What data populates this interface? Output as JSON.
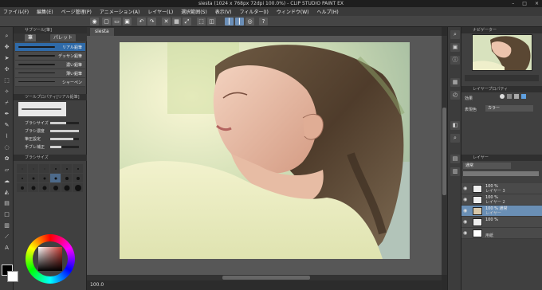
{
  "window": {
    "title": "siesta (1024 x 768px 72dpi 100.0%) - CLIP STUDIO PAINT EX",
    "controls": [
      "–",
      "□",
      "×"
    ]
  },
  "menu": [
    "ファイル(F)",
    "編集(E)",
    "ページ管理(P)",
    "アニメーション(A)",
    "レイヤー(L)",
    "選択範囲(S)",
    "表示(V)",
    "フィルター(I)",
    "ウィンドウ(W)",
    "ヘルプ(H)"
  ],
  "subtool": {
    "header": "サブツール[筆]",
    "tabs": [
      "筆",
      "パレット"
    ],
    "brushes": [
      {
        "label": "リアル鉛筆",
        "selected": true
      },
      {
        "label": "デッサン鉛筆",
        "selected": false
      },
      {
        "label": "濃い鉛筆",
        "selected": false
      },
      {
        "label": "薄い鉛筆",
        "selected": false
      },
      {
        "label": "シャーペン",
        "selected": false
      }
    ]
  },
  "tool_property": {
    "header": "ツールプロパティ[リアル鉛筆]",
    "rows": [
      {
        "label": "ブラシサイズ",
        "value": 0.55
      },
      {
        "label": "ブラシ濃度",
        "value": 1.0
      },
      {
        "label": "筆圧設定",
        "value": 0.8
      },
      {
        "label": "手ブレ補正",
        "value": 0.4
      }
    ]
  },
  "brush_size": {
    "header": "ブラシサイズ",
    "selected_index": 9
  },
  "document_tab": "siesta",
  "status": {
    "zoom": "100.0"
  },
  "right_panel": {
    "navigator_header": "ナビゲーター",
    "property_header": "レイヤープロパティ",
    "effect_label": "効果",
    "color_label": "表現色",
    "color_value": "カラー",
    "layer_header": "レイヤー",
    "blend_mode": "通常",
    "layers": [
      {
        "name": "100 %",
        "sub": "レイヤー 3",
        "selected": false
      },
      {
        "name": "100 %",
        "sub": "レイヤー 2",
        "selected": false
      },
      {
        "name": "100 % 通常",
        "sub": "レイヤー",
        "selected": true
      },
      {
        "name": "100 %",
        "sub": "",
        "selected": false
      },
      {
        "name": "",
        "sub": "用紙",
        "selected": false
      }
    ]
  }
}
